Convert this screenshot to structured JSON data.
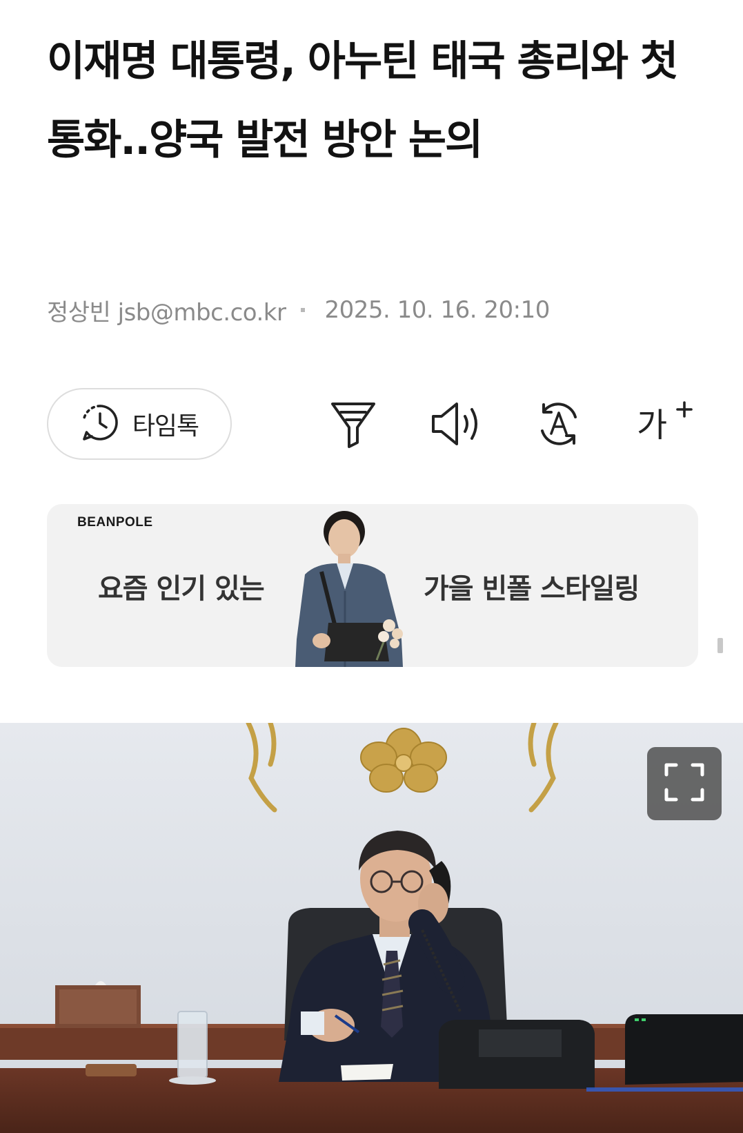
{
  "article": {
    "headline": "이재명 대통령, 아누틴 태국 총리와 첫 통화..양국 발전 방안 논의",
    "byline": {
      "author": "정상빈 jsb@mbc.co.kr",
      "datetime": "2025. 10. 16. 20:10"
    }
  },
  "toolbar": {
    "timetalk_label": "타임톡",
    "font_size_label": "가",
    "icons": [
      "clock-chat-icon",
      "filter-icon",
      "speaker-icon",
      "translate-icon",
      "font-size-icon"
    ]
  },
  "ad": {
    "brand": "BEANPOLE",
    "text_left": "요즘 인기 있는",
    "text_right": "가을 빈폴 스타일링"
  },
  "photo": {
    "fullscreen_icon": "fullscreen-icon"
  },
  "colors": {
    "headline": "#121212",
    "meta": "#8a8a8a",
    "ad_background": "#f2f2f2",
    "wall": "#dfe3e8",
    "desk": "#5a2d1e"
  }
}
